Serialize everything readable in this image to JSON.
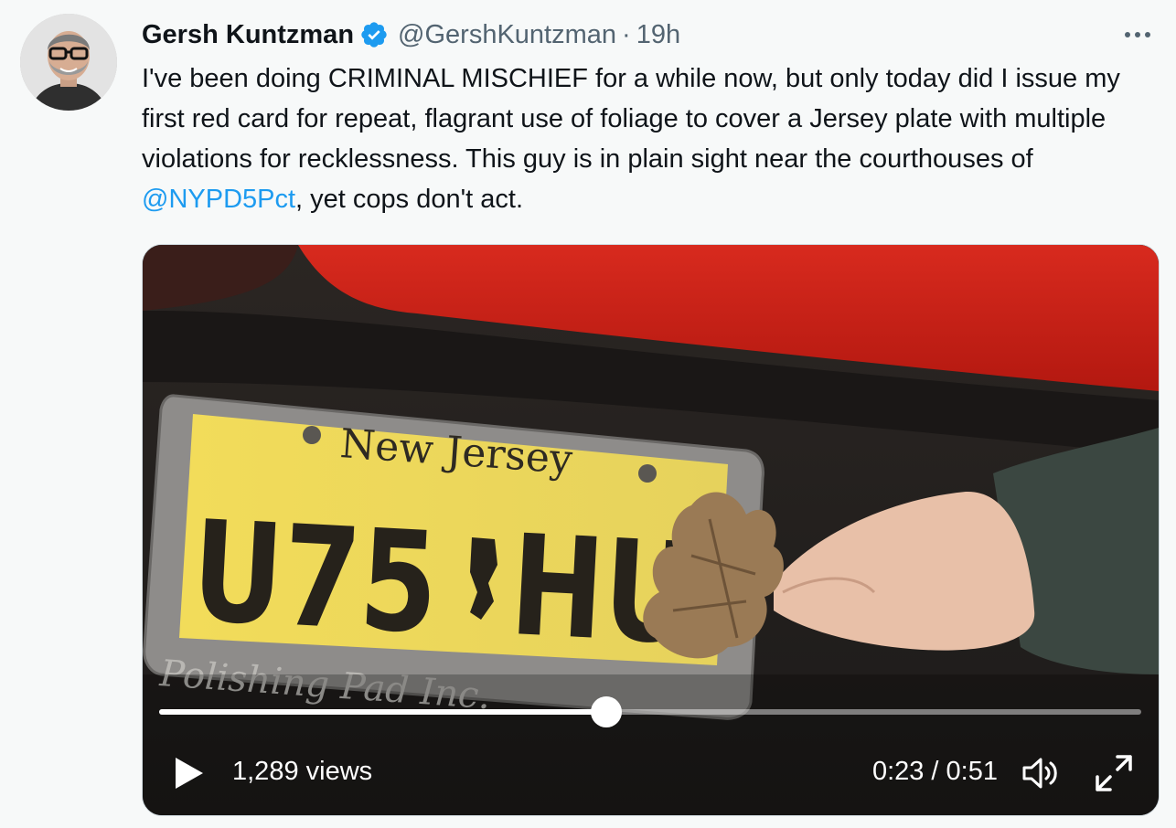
{
  "tweet": {
    "author": {
      "display_name": "Gersh Kuntzman",
      "handle": "@GershKuntzman",
      "verified": true
    },
    "separator": "·",
    "time": "19h",
    "more_icon": "more-horizontal-icon",
    "text": {
      "part1": "I've been doing CRIMINAL MISCHIEF for a while now, but only today did I issue my first red card for repeat, flagrant use of foliage to cover a Jersey plate with multiple violations for recklessness. This guy is in plain sight near the courthouses of ",
      "mention": "@NYPD5Pct",
      "part2": ", yet cops don't act."
    }
  },
  "video": {
    "plate": {
      "state": "New Jersey",
      "left_chars": "U75",
      "right_chars": "HU",
      "frame_text": "Polishing Pad Inc."
    },
    "progress": 0.455,
    "views": "1,289 views",
    "timecode": "0:23 / 0:51",
    "icons": {
      "play": "play-icon",
      "volume": "volume-icon",
      "fullscreen": "fullscreen-icon"
    }
  },
  "colors": {
    "text": "#0f1419",
    "secondary": "#536471",
    "link": "#1d9bf0",
    "verified": "#1d9bf0",
    "background": "#f7f9f9"
  }
}
